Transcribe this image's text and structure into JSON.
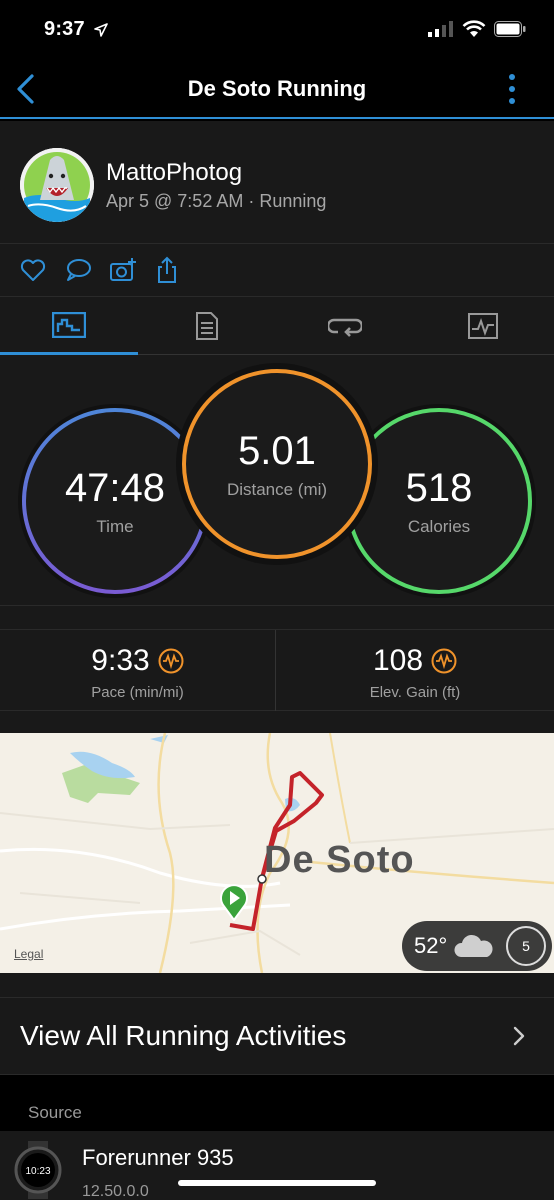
{
  "status_bar": {
    "time": "9:37"
  },
  "nav": {
    "title": "De Soto Running"
  },
  "profile": {
    "username": "MattoPhotog",
    "meta": "Apr 5 @ 7:52 AM · Running"
  },
  "stats": {
    "time": {
      "value": "47:48",
      "label": "Time"
    },
    "distance": {
      "value": "5.01",
      "label": "Distance (mi)"
    },
    "calories": {
      "value": "518",
      "label": "Calories"
    }
  },
  "metrics": {
    "pace": {
      "value": "9:33",
      "label": "Pace (min/mi)"
    },
    "elev": {
      "value": "108",
      "label": "Elev. Gain (ft)"
    }
  },
  "map": {
    "place_label": "De Soto",
    "legal": "Legal",
    "temperature": "52°",
    "wind": "5"
  },
  "view_all": {
    "label": "View All Running Activities"
  },
  "source": {
    "header": "Source",
    "device_name": "Forerunner 935",
    "version": "12.50.0.0",
    "watch_face": "10:23"
  },
  "colors": {
    "accent": "#2f8fd6",
    "time_ring": "#4e86d9",
    "distance_ring": "#f0932b",
    "calories_ring": "#56d86a",
    "route": "#c4232a"
  }
}
